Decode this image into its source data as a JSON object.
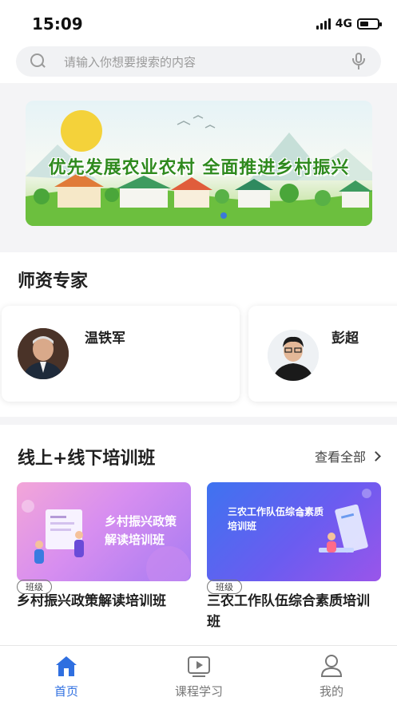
{
  "status_bar": {
    "time": "15:09",
    "network": "4G"
  },
  "search": {
    "placeholder": "请输入你想要搜索的内容"
  },
  "banner": {
    "title": "优先发展农业农村  全面推进乡村振兴"
  },
  "experts_section": {
    "title": "师资专家",
    "items": [
      {
        "name": "温铁军"
      },
      {
        "name": "彭超"
      }
    ]
  },
  "courses_section": {
    "title": "线上+线下培训班",
    "see_all": "查看全部",
    "items": [
      {
        "image_caption_line1": "乡村振兴政策",
        "image_caption_line2": "解读培训班",
        "title": "乡村振兴政策解读培训班",
        "tag": "班级"
      },
      {
        "image_caption_line1": "三农工作队伍综合素质",
        "image_caption_line2": "培训班",
        "title": "三农工作队伍综合素质培训班",
        "tag": "班级"
      }
    ]
  },
  "tabbar": {
    "items": [
      {
        "label": "首页",
        "icon": "home-icon",
        "active": true
      },
      {
        "label": "课程学习",
        "icon": "video-play-icon",
        "active": false
      },
      {
        "label": "我的",
        "icon": "user-icon",
        "active": false
      }
    ]
  },
  "colors": {
    "accent": "#2f6fe0",
    "banner_title": "#2f8a1e"
  }
}
